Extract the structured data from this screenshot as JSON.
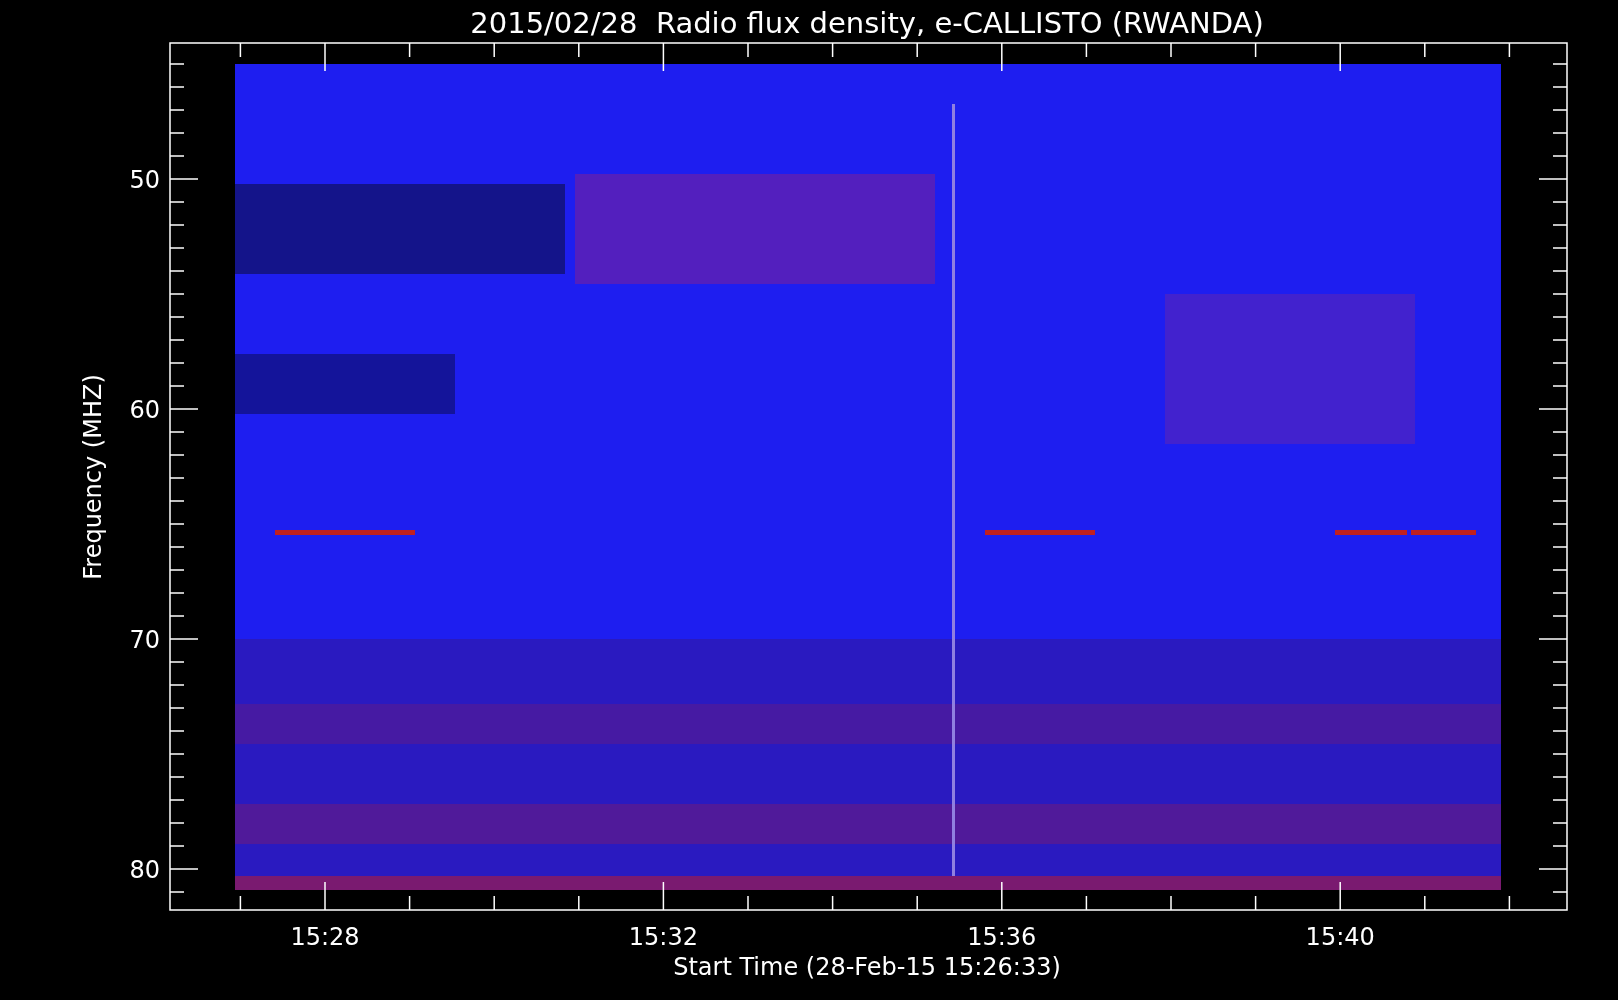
{
  "title": "2015/02/28  Radio flux density, e-CALLISTO (RWANDA)",
  "y_axis": {
    "label": "Frequency (MHZ)",
    "ticks": [
      "50",
      "60",
      "70",
      "80"
    ]
  },
  "x_axis": {
    "label": "Start Time (28-Feb-15 15:26:33)",
    "ticks": [
      "15:28",
      "15:32",
      "15:36",
      "15:40"
    ]
  }
}
